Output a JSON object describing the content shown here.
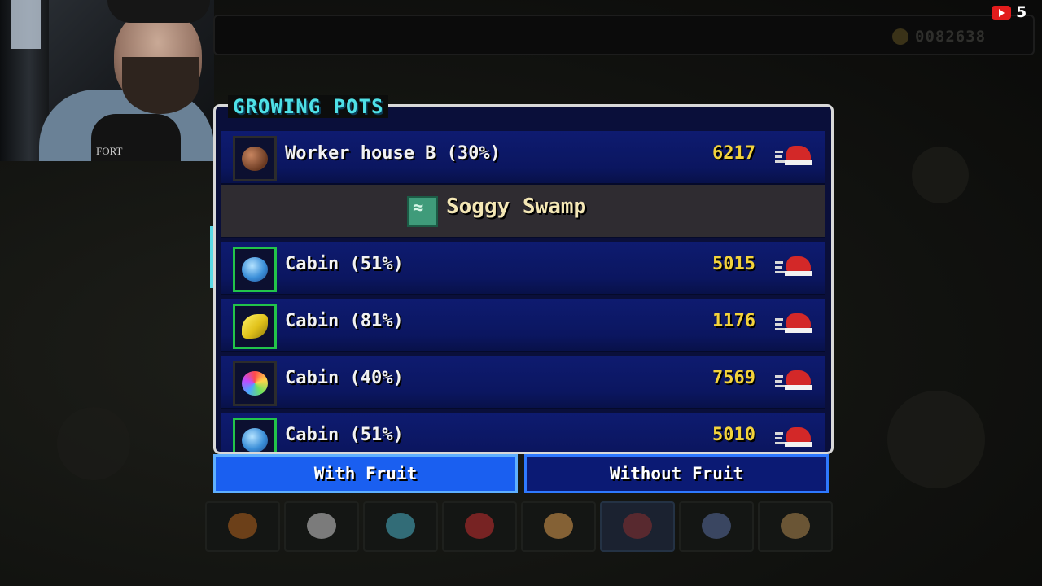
{
  "stream": {
    "viewer_count": "5"
  },
  "hud": {
    "money": "0082638"
  },
  "webcam": {
    "shirt_text": "FORT"
  },
  "panel": {
    "title": "GROWING POTS",
    "rows": [
      {
        "kind": "pot",
        "label": "Worker house B (30%)",
        "value": "6217",
        "fruit": "brown-nut",
        "border": "plain"
      },
      {
        "kind": "header",
        "label": "Soggy Swamp",
        "icon": "swamp-area-icon"
      },
      {
        "kind": "pot",
        "label": "Cabin (51%)",
        "value": "5015",
        "fruit": "blueberry-cluster",
        "border": "green"
      },
      {
        "kind": "pot",
        "label": "Cabin (81%)",
        "value": "1176",
        "fruit": "banana-bunch",
        "border": "green"
      },
      {
        "kind": "pot",
        "label": "Cabin (40%)",
        "value": "7569",
        "fruit": "rainbow-fruit",
        "border": "plain"
      },
      {
        "kind": "pot",
        "label": "Cabin (51%)",
        "value": "5010",
        "fruit": "blueberry-cluster",
        "border": "green"
      }
    ]
  },
  "tabs": {
    "with_fruit": "With Fruit",
    "without_fruit": "Without Fruit",
    "active": "with_fruit"
  },
  "toolbar": {
    "items": [
      "fruit-basket-icon",
      "shirt-icon",
      "gems-icon",
      "apple-icon",
      "potion-icon",
      "book-icon",
      "pie-icon",
      "crate-icon"
    ],
    "selected_index": 5
  },
  "colors": {
    "title": "#4fe0e6",
    "value": "#f3d33c",
    "active_tab": "#1a5ff0",
    "panel_bg": "#0a0f3a"
  }
}
